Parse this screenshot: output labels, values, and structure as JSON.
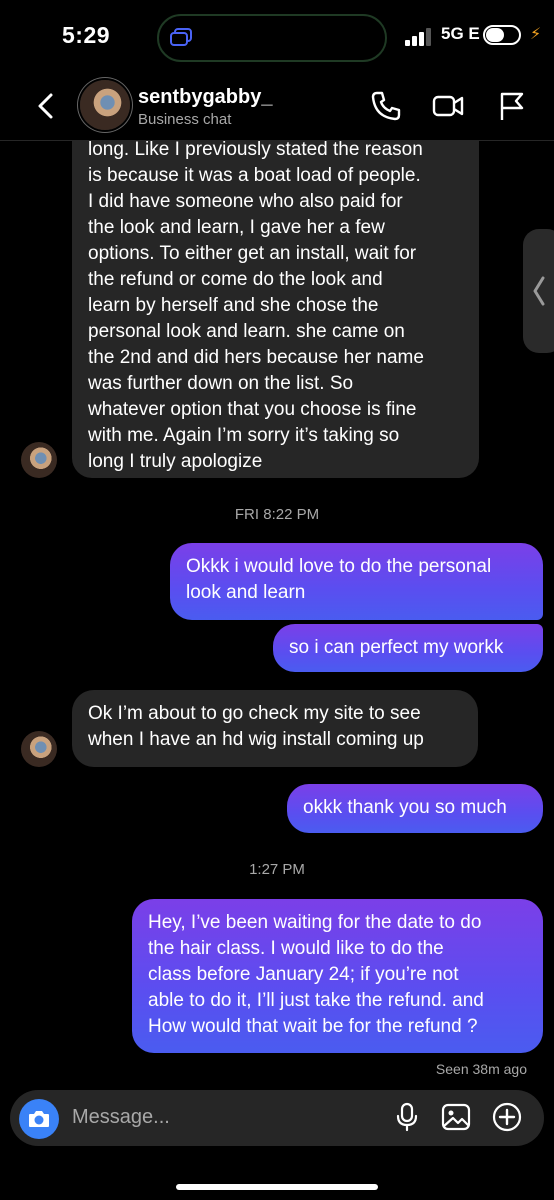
{
  "status_bar": {
    "time": "5:29",
    "network": "5G E"
  },
  "header": {
    "username": "sentbygabby_",
    "subtitle": "Business chat"
  },
  "messages": {
    "m1": "long. Like I previously stated the reason\nis because it was a boat load of people.\nI did have someone who also paid for\nthe look and learn, I gave her a few\noptions. To either get an install, wait for\nthe refund or come do the look and\nlearn by herself and she chose the\npersonal look and learn. she came on\nthe 2nd and did hers because her name\nwas further down on the list. So\nwhatever option that you choose is fine\nwith me. Again I’m sorry it’s taking so\nlong I truly apologize",
    "ts1": "FRI 8:22 PM",
    "m2": "Okkk i would love to do the personal\nlook and learn",
    "m3": "so i can perfect my workk",
    "m4": "Ok I’m about to go check my site to see\nwhen I have an hd wig install coming up",
    "m5": "okkk thank you so much",
    "ts2": "1:27 PM",
    "m6": "Hey, I’ve been waiting for the date to do\nthe hair class. I would like to do the\nclass before January 24; if you’re not\nable to do it, I’ll just take the refund. and\nHow would that wait be for the refund ?",
    "seen": "Seen 38m ago"
  },
  "composer": {
    "placeholder": "Message..."
  },
  "icons": {
    "back": "chevron-left-icon",
    "call": "phone-icon",
    "video": "video-camera-icon",
    "report": "flag-icon",
    "camera": "camera-icon",
    "mic": "microphone-icon",
    "gallery": "image-icon",
    "add": "plus-circle-icon"
  },
  "colors": {
    "background": "#000000",
    "incoming_bubble": "#262626",
    "outgoing_bubble_top": "#7b3fe8",
    "outgoing_bubble_bottom": "#4a5cf0",
    "camera_button": "#3a82f7"
  }
}
